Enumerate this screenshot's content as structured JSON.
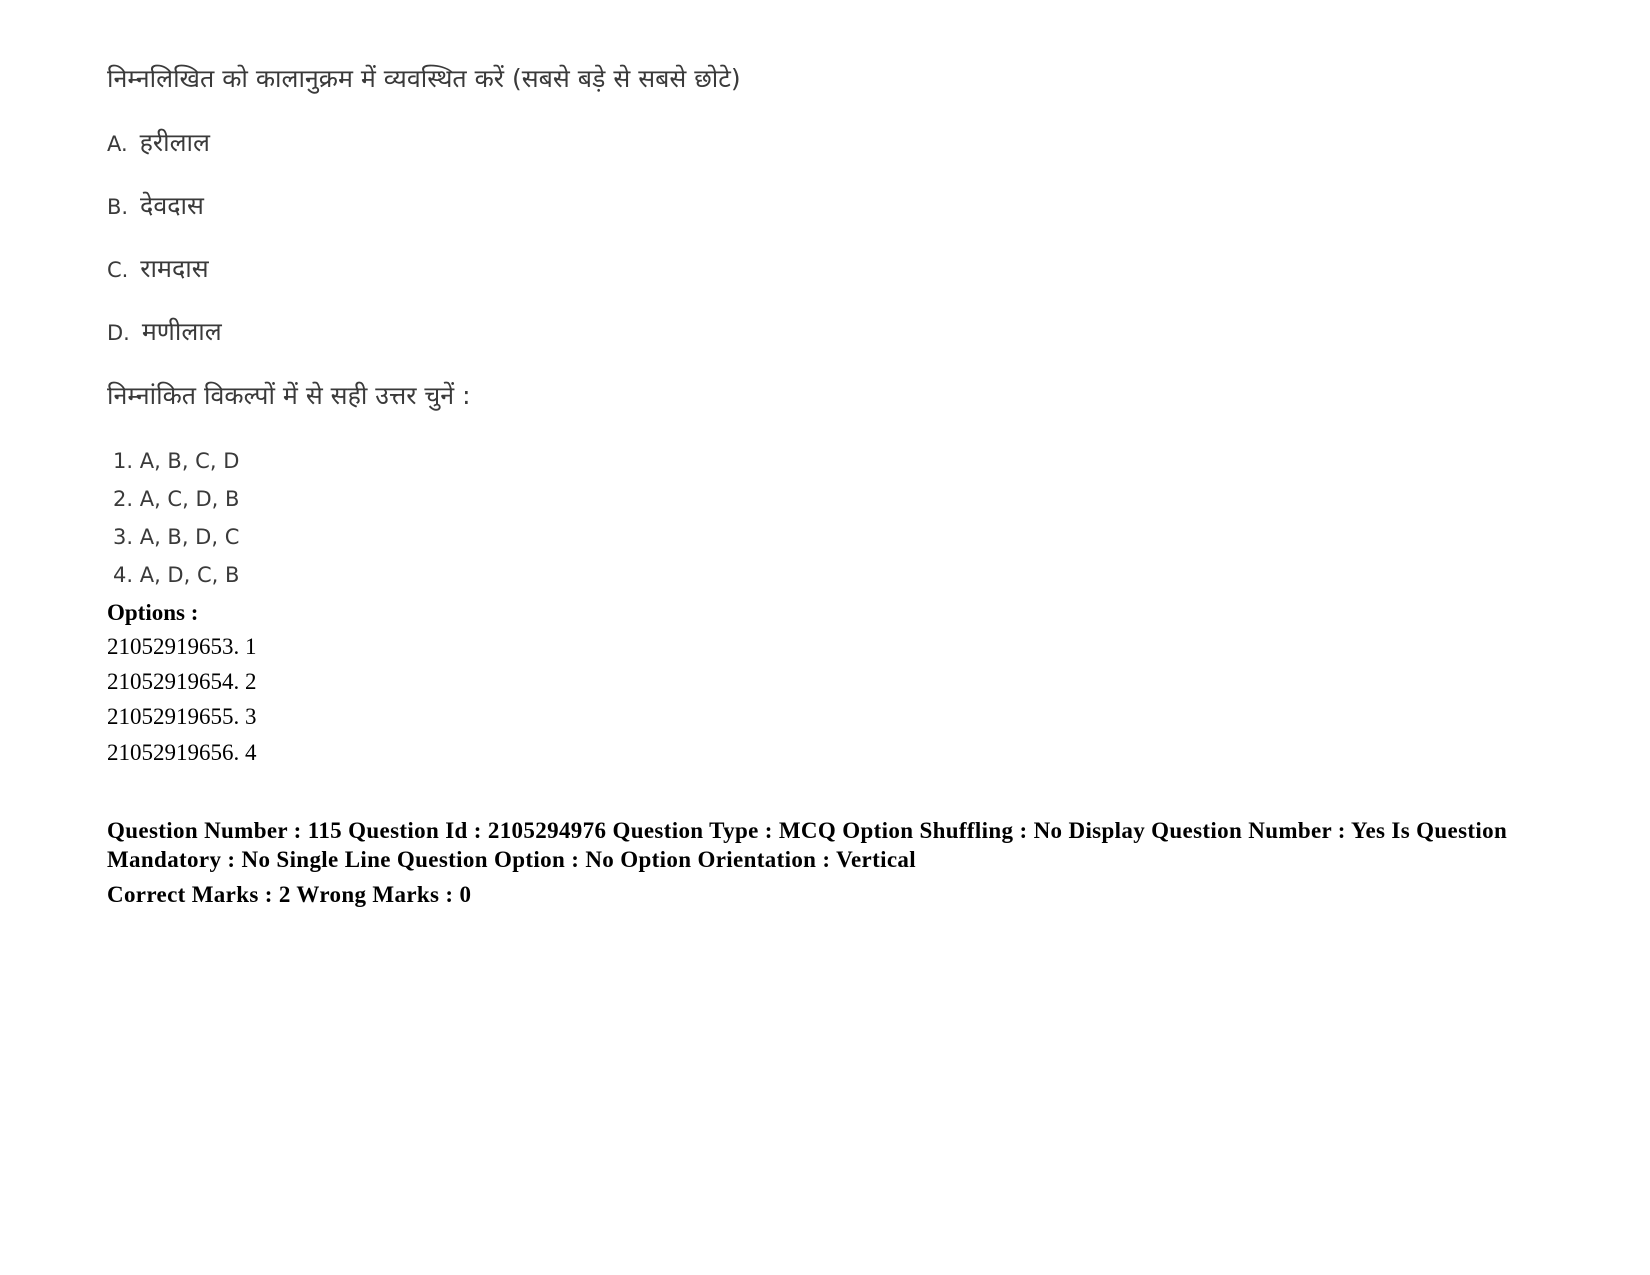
{
  "question": {
    "prompt": "निम्नलिखित को कालानुक्रम में व्यवस्थित करें (सबसे बड़े से सबसे छोटे)",
    "statements": [
      {
        "letter": "A.",
        "text": "हरीलाल"
      },
      {
        "letter": "B.",
        "text": "देवदास"
      },
      {
        "letter": "C.",
        "text": "रामदास"
      },
      {
        "letter": "D.",
        "text": "मणीलाल"
      }
    ],
    "instruction": "निम्नांकित विकल्पों में से सही उत्तर चुनें :",
    "choices": [
      "1. A, B, C, D",
      "2. A, C, D, B",
      "3. A, B, D, C",
      "4. A, D, C, B"
    ]
  },
  "options": {
    "heading": "Options :",
    "items": [
      "21052919653. 1",
      "21052919654. 2",
      "21052919655. 3",
      "21052919656. 4"
    ]
  },
  "meta": {
    "details": "Question Number : 115 Question Id : 2105294976 Question Type : MCQ Option Shuffling : No Display Question Number : Yes Is Question Mandatory : No Single Line Question Option : No Option Orientation : Vertical",
    "marks": "Correct Marks : 2 Wrong Marks : 0"
  }
}
